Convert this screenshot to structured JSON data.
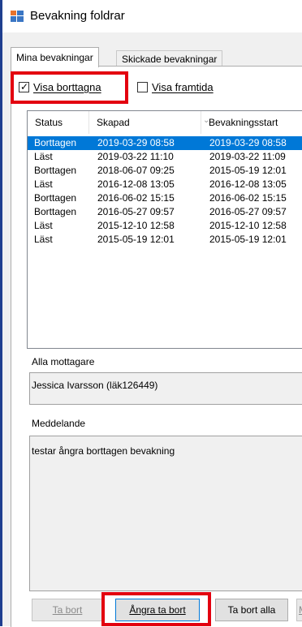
{
  "window": {
    "title": "Bevakning foldrar"
  },
  "tabs": [
    {
      "label": "Mina bevakningar"
    },
    {
      "label": "Skickade bevakningar"
    }
  ],
  "filters": {
    "show_deleted": {
      "label": "Visa borttagna",
      "checked": true
    },
    "show_future": {
      "label": "Visa framtida",
      "checked": false
    }
  },
  "table": {
    "columns": [
      "Status",
      "Skapad",
      "Bevakningsstart"
    ],
    "rows": [
      {
        "status": "Borttagen",
        "skapad": "2019-03-29 08:58",
        "start": "2019-03-29 08:58",
        "selected": true
      },
      {
        "status": "Läst",
        "skapad": "2019-03-22 11:10",
        "start": "2019-03-22 11:09",
        "selected": false
      },
      {
        "status": "Borttagen",
        "skapad": "2018-06-07 09:25",
        "start": "2015-05-19 12:01",
        "selected": false
      },
      {
        "status": "Läst",
        "skapad": "2016-12-08 13:05",
        "start": "2016-12-08 13:05",
        "selected": false
      },
      {
        "status": "Borttagen",
        "skapad": "2016-06-02 15:15",
        "start": "2016-06-02 15:15",
        "selected": false
      },
      {
        "status": "Borttagen",
        "skapad": "2016-05-27 09:57",
        "start": "2016-05-27 09:57",
        "selected": false
      },
      {
        "status": "Läst",
        "skapad": "2015-12-10 12:58",
        "start": "2015-12-10 12:58",
        "selected": false
      },
      {
        "status": "Läst",
        "skapad": "2015-05-19 12:01",
        "start": "2015-05-19 12:01",
        "selected": false
      }
    ]
  },
  "recipients": {
    "label": "Alla mottagare",
    "value": "Jessica Ivarsson (läk126449)"
  },
  "message": {
    "label": "Meddelande",
    "value": "testar ångra borttagen bevakning"
  },
  "buttons": {
    "remove": "Ta bort",
    "undo_remove": "Ångra ta bort",
    "remove_all": "Ta bort alla",
    "partial": "M"
  },
  "colors": {
    "highlight": "#e3000f",
    "selection": "#0078d7",
    "window_border": "#1f3f8f"
  }
}
